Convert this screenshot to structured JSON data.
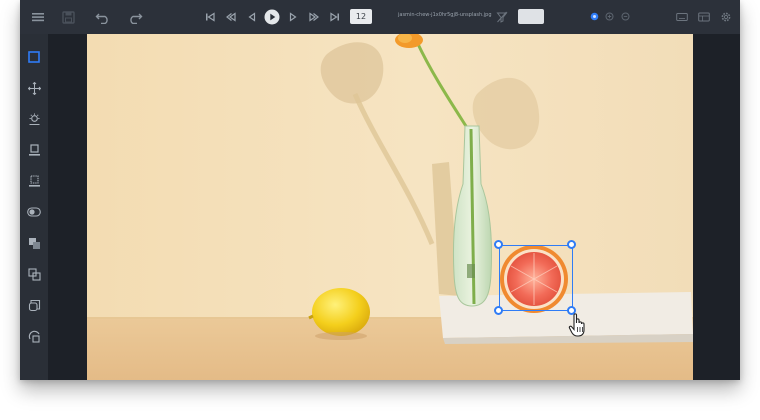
{
  "app": {
    "accent_color": "#2f7cf6",
    "toolbar_bg": "#2c313a",
    "sidebar_bg": "#2a2f37"
  },
  "toolbar": {
    "menu_icon": "hamburger-menu-icon",
    "save_icon": "save-icon",
    "undo_icon": "undo-icon",
    "redo_icon": "redo-icon",
    "frame_number": "12",
    "filename": "jasmin-chew-j1x0hr5gj8-unsplash.jpg",
    "frame_step_value": "",
    "right_icons": [
      "keyboard-icon",
      "layout-icon",
      "settings-gear-icon"
    ]
  },
  "sidebar": {
    "tools": [
      {
        "name": "rectangle-tool",
        "active": true
      },
      {
        "name": "move-tool",
        "active": false
      },
      {
        "name": "brightness-tool",
        "active": false
      },
      {
        "name": "tag-tool",
        "active": false
      },
      {
        "name": "merge-tool",
        "active": false
      },
      {
        "name": "toggle-visibility-tool",
        "active": false
      },
      {
        "name": "group-tool",
        "active": false
      },
      {
        "name": "ungroup-tool",
        "active": false
      },
      {
        "name": "copy-shape-tool",
        "active": false
      },
      {
        "name": "paste-shape-tool",
        "active": false
      }
    ]
  },
  "annotation": {
    "type": "rectangle",
    "object": "grapefruit",
    "color": "#2f7cf6"
  }
}
